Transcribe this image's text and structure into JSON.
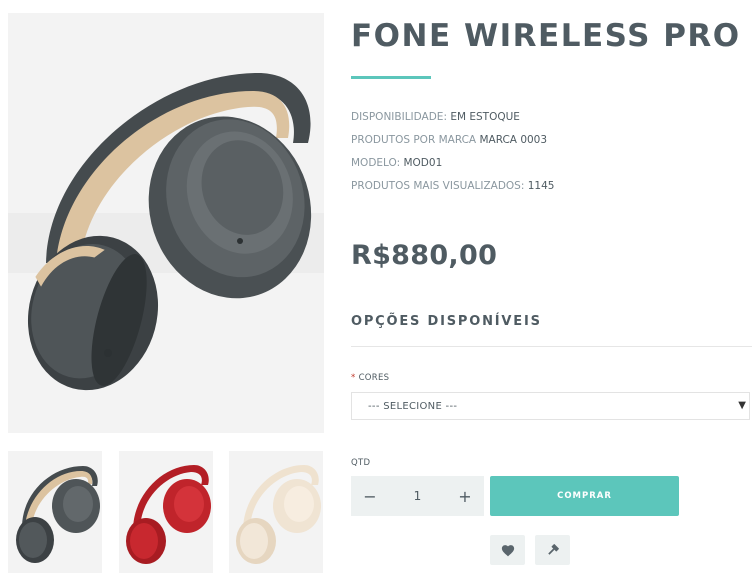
{
  "product": {
    "title": "FONE WIRELESS PRO",
    "specs": [
      {
        "label": "DISPONIBILIDADE:",
        "value": "EM ESTOQUE"
      },
      {
        "label": "PRODUTOS POR MARCA",
        "value": "MARCA 0003"
      },
      {
        "label": "MODELO:",
        "value": "MOD01"
      },
      {
        "label": "PRODUTOS MAIS VISUALIZADOS:",
        "value": "1145"
      }
    ],
    "price": "R$880,00"
  },
  "options": {
    "title": "OPÇÕES DISPONÍVEIS",
    "required_mark": "*",
    "cores_label": "CORES",
    "select_value": "--- SELECIONE ---"
  },
  "purchase": {
    "qty_label": "QTD",
    "qty_value": "1",
    "minus": "−",
    "plus": "+",
    "buy_label": "COMPRAR"
  },
  "colors": {
    "accent": "#5cc6bb",
    "text": "#4f5b62",
    "muted": "#8a979f",
    "button_bg": "#edf1f1"
  },
  "gallery": {
    "thumb_colors": [
      "dark-gray",
      "red",
      "cream"
    ]
  }
}
